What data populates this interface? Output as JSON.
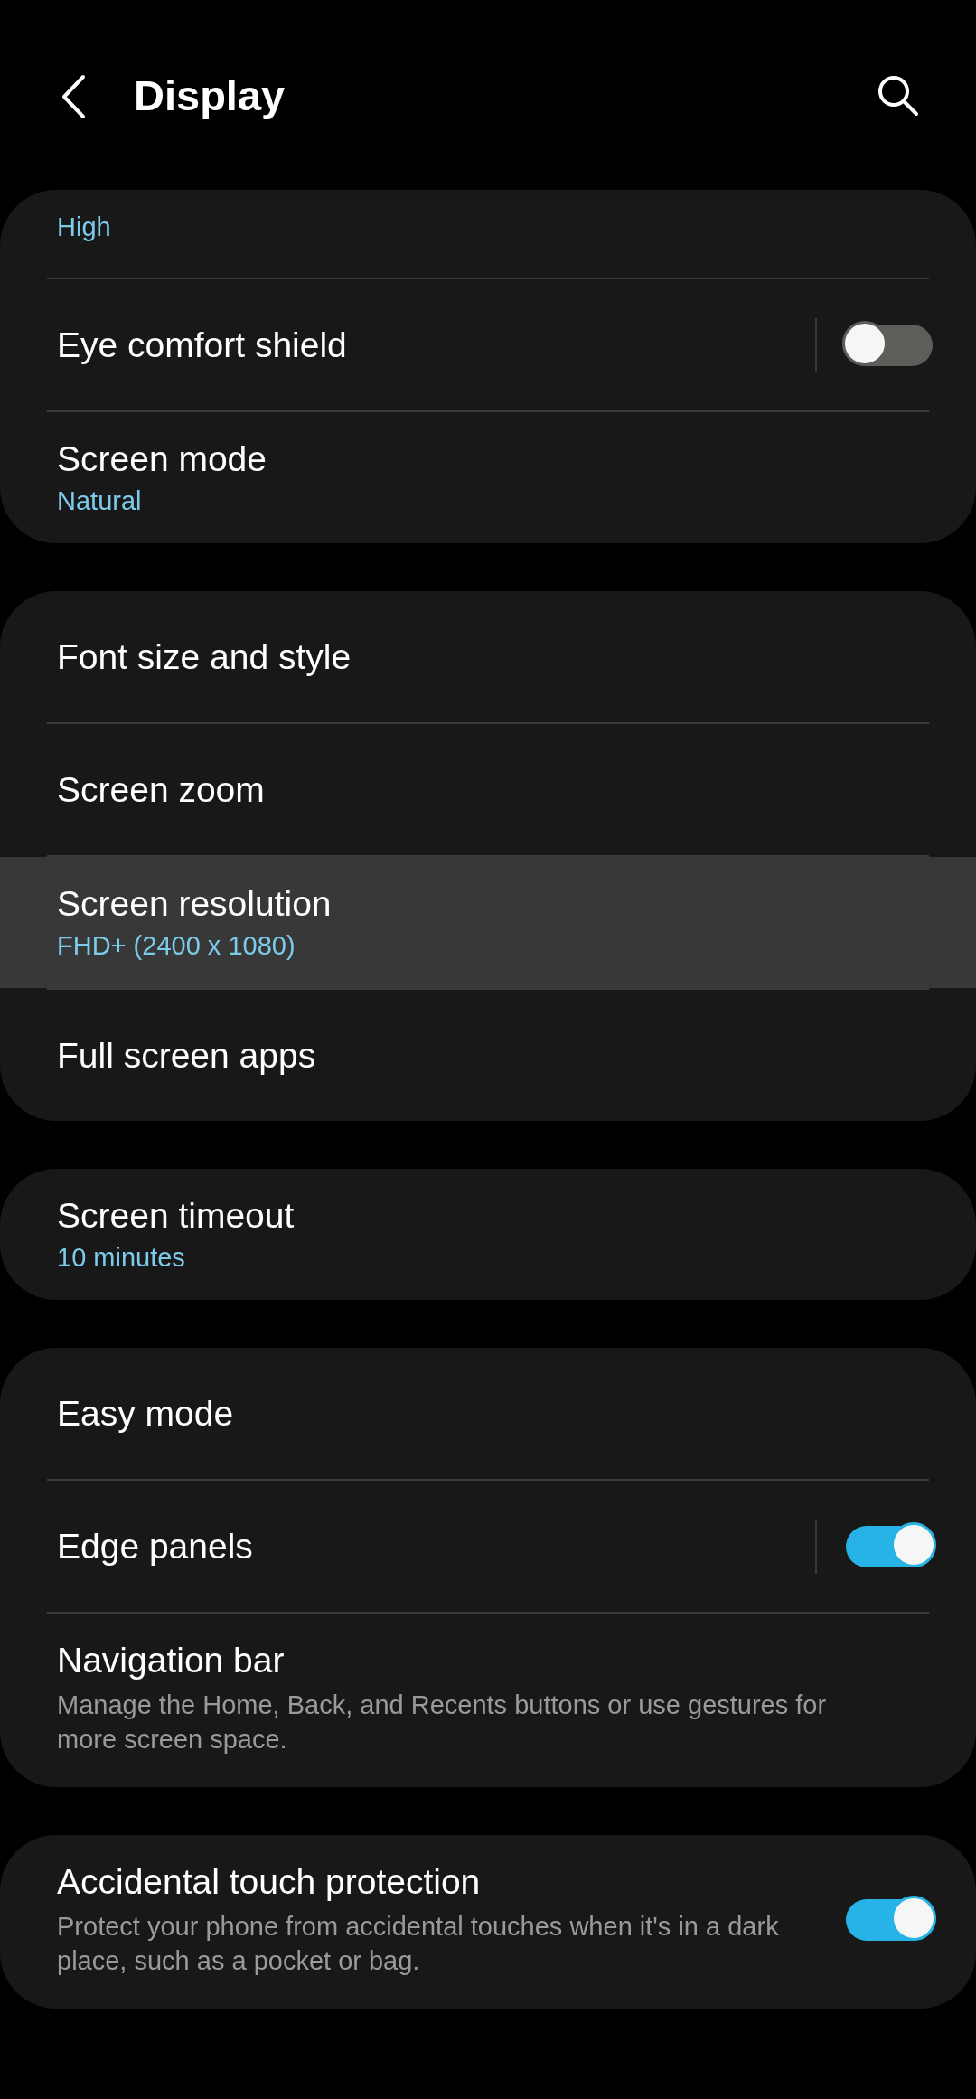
{
  "header": {
    "title": "Display"
  },
  "groups": [
    {
      "items": [
        {
          "kind": "link",
          "subtitle": "High",
          "highlighted": false
        },
        {
          "kind": "switch",
          "title": "Eye comfort shield",
          "on": false,
          "highlighted": false
        },
        {
          "kind": "link",
          "title": "Screen mode",
          "subtitle": "Natural",
          "highlighted": false
        }
      ]
    },
    {
      "items": [
        {
          "kind": "link",
          "title": "Font size and style",
          "highlighted": false
        },
        {
          "kind": "link",
          "title": "Screen zoom",
          "highlighted": false
        },
        {
          "kind": "link",
          "title": "Screen resolution",
          "subtitle": "FHD+ (2400 x 1080)",
          "highlighted": true
        },
        {
          "kind": "link",
          "title": "Full screen apps",
          "highlighted": false
        }
      ]
    },
    {
      "items": [
        {
          "kind": "link",
          "title": "Screen timeout",
          "subtitle": "10 minutes",
          "highlighted": false
        }
      ]
    },
    {
      "items": [
        {
          "kind": "link",
          "title": "Easy mode",
          "highlighted": false
        },
        {
          "kind": "switch",
          "title": "Edge panels",
          "on": true,
          "highlighted": false
        },
        {
          "kind": "link",
          "title": "Navigation bar",
          "description": "Manage the Home, Back, and Recents buttons or use gestures for more screen space.",
          "highlighted": false
        }
      ]
    },
    {
      "items": [
        {
          "kind": "toggle",
          "title": "Accidental touch protection",
          "description": "Protect your phone from accidental touches when it's in a dark place, such as a pocket or bag.",
          "on": true,
          "highlighted": false
        }
      ]
    }
  ]
}
